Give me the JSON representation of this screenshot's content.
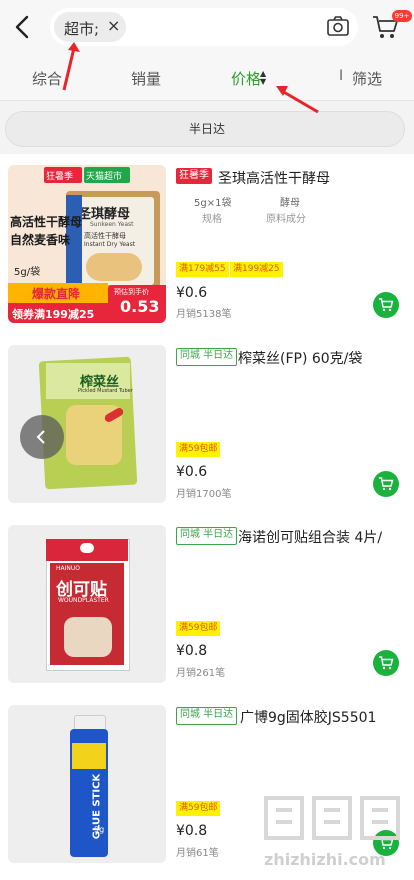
{
  "header": {
    "search_chip": "超市;",
    "chip_close": "×",
    "cart_badge": "99+",
    "icons": [
      "back-icon",
      "camera-icon",
      "cart-icon"
    ]
  },
  "sort_tabs": {
    "comprehensive": "综合",
    "sales": "销量",
    "price": "价格",
    "filter": "筛选",
    "filter_separator": "I",
    "active_color": "#2ca02c"
  },
  "half_day_filter": "半日达",
  "products": [
    {
      "badge": "狂暑季",
      "title": "圣琪高活性干酵母",
      "spec_value_1": "5g×1袋",
      "spec_key_1": "规格",
      "spec_value_2": "酵母",
      "spec_key_2": "原料成分",
      "promo_1": "满179减55",
      "promo_2": "满199减25",
      "price": "¥0.6",
      "sold": "月销5138笔",
      "image": {
        "flag_1": "狂暑季",
        "flag_2": "天猫超市",
        "brand": "圣琪酵母",
        "brand_en": "Sunkeen Yeast",
        "sub_1": "高活性干酵母",
        "sub_2": "Instant Dry Yeast",
        "side_1": "高活性干酵母",
        "side_2": "自然麦香味",
        "weight": "5g/袋",
        "banner": "爆款直降",
        "coupon": "领券满199减25",
        "est_label": "预估到手价",
        "est_price": "0.53"
      }
    },
    {
      "badge": "同城 半日达",
      "title": "榨菜丝(FP) 60克/袋",
      "promo_1": "满59包邮",
      "price": "¥0.6",
      "sold": "月销1700笔",
      "image": {
        "label": "榨菜丝",
        "sub": "Pickled Mustard Tuber"
      }
    },
    {
      "badge": "同城 半日达",
      "title": "海诺创可贴组合装 4片/",
      "promo_1": "满59包邮",
      "price": "¥0.8",
      "sold": "月销261笔",
      "image": {
        "brand": "HAINUO",
        "label": "创可贴",
        "sub": "WOUNDPLASTER"
      }
    },
    {
      "badge": "同城 半日达",
      "title": "广博9g固体胶JS5501",
      "promo_1": "满59包邮",
      "price": "¥0.8",
      "sold": "月销61笔",
      "image": {
        "label": "GLUE STICK",
        "sub": "9g"
      }
    }
  ],
  "watermark": "zhizhizhi.com",
  "colors": {
    "accent_green": "#19b23c",
    "badge_red": "#e8263b",
    "promo_yellow": "#fff200",
    "annotation_red": "#e8242b"
  }
}
